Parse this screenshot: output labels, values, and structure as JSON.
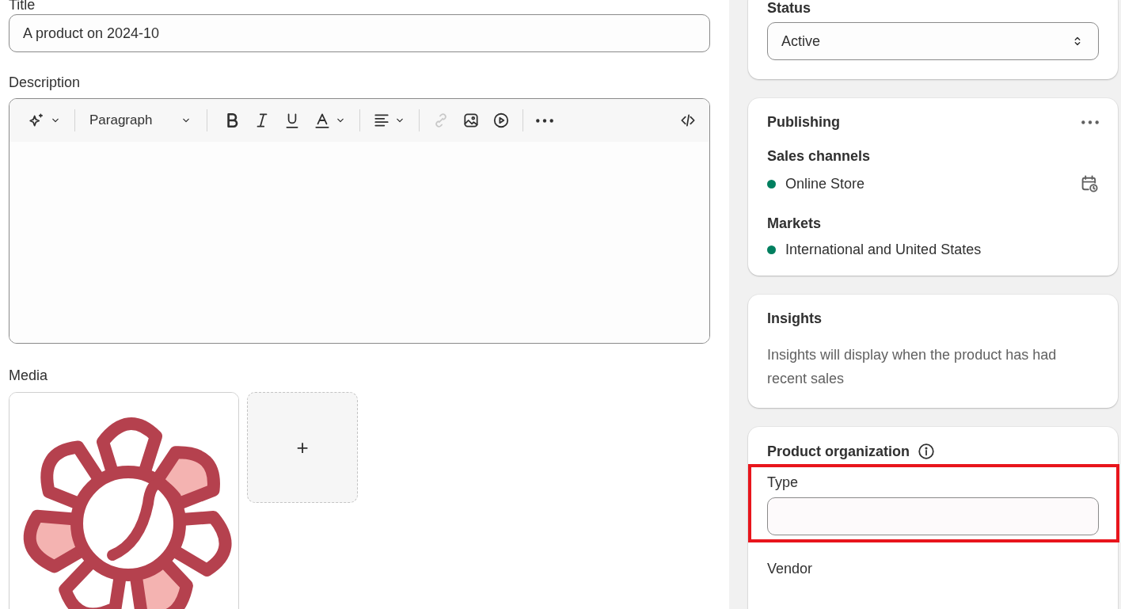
{
  "main": {
    "title_label": "Title",
    "title_value": "A product on 2024-10",
    "description_label": "Description",
    "toolbar": {
      "style_label": "Paragraph",
      "buttons": [
        {
          "disabled": false
        },
        {
          "disabled": false
        },
        {
          "disabled": false
        },
        {
          "disabled": false
        },
        {
          "disabled": false
        },
        {
          "disabled": false
        },
        {
          "disabled": true
        },
        {
          "disabled": false
        },
        {
          "disabled": false
        },
        {
          "disabled": false
        },
        {
          "disabled": false
        }
      ]
    },
    "media_label": "Media",
    "media": [
      {
        "kind": "picture"
      },
      {
        "kind": "add",
        "label": "+"
      }
    ]
  },
  "sidebar": {
    "status": {
      "label": "Status",
      "value": "Active"
    },
    "publishing": {
      "title": "Publishing",
      "sections": [
        {
          "heading": "Sales channels",
          "items": [
            {
              "name": "Online Store",
              "color": "#007f5f",
              "schedule": true
            }
          ]
        },
        {
          "heading": "Markets",
          "items": [
            {
              "name": "International and United States",
              "color": "#007f5f",
              "schedule": false
            }
          ]
        }
      ]
    },
    "insights": {
      "title": "Insights",
      "text": "Insights will display when the product has had recent sales"
    },
    "organization": {
      "title": "Product organization",
      "fields": [
        {
          "label": "Type",
          "kind": "input",
          "highlighted": true
        },
        {
          "label": "Vendor",
          "kind": "label",
          "highlighted": false
        }
      ]
    }
  }
}
